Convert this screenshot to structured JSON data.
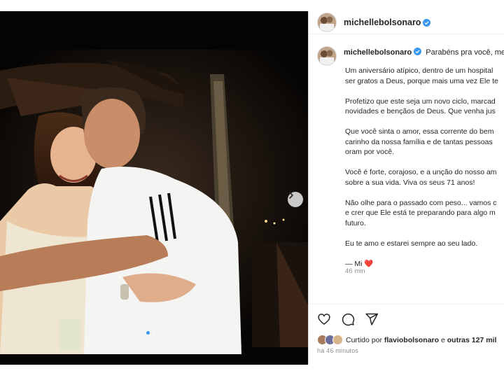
{
  "post": {
    "username": "michellebolsonaro",
    "verified": true,
    "caption_user": "michellebolsonaro",
    "caption_first_line": "Parabéns pra você, meu",
    "paragraphs": [
      [
        "Um aniversário atípico, dentro de um hospital",
        "ser gratos a Deus, porque mais uma vez Ele te"
      ],
      [
        "Profetizo que este seja um novo ciclo, marcad",
        "novidades e bençãos de Deus. Que venha jus"
      ],
      [
        "Que você sinta o amor, essa corrente do bem",
        "carinho da nossa família e de tantas pessoas",
        "oram por você."
      ],
      [
        "Você é forte, corajoso, e a unção do nosso am",
        "sobre a sua vida. Viva os seus 71 anos!"
      ],
      [
        "Não olhe para o passado com peso... vamos c",
        "e crer que Ele está te preparando para algo m",
        "futuro."
      ],
      [
        "Eu te amo e estarei sempre ao seu lado."
      ]
    ],
    "signature": "— Mi",
    "signature_heart": "❤️",
    "caption_time": "46 min",
    "liked_by_prefix": "Curtido por",
    "liked_by_user": "flaviobolsonaro",
    "liked_by_conj": "e",
    "liked_by_others": "outras 127 mil",
    "post_time": "há 46 minutos",
    "carousel": {
      "total": 3,
      "active": 0
    }
  },
  "icons": {
    "verified": "verified-badge-icon",
    "heart": "heart-icon",
    "comment": "comment-icon",
    "share": "share-icon",
    "next": "chevron-right-icon"
  },
  "colors": {
    "verified": "#3897f0",
    "heart_emoji": "#e0245e",
    "muted": "#8e8e8e",
    "text": "#262626"
  }
}
